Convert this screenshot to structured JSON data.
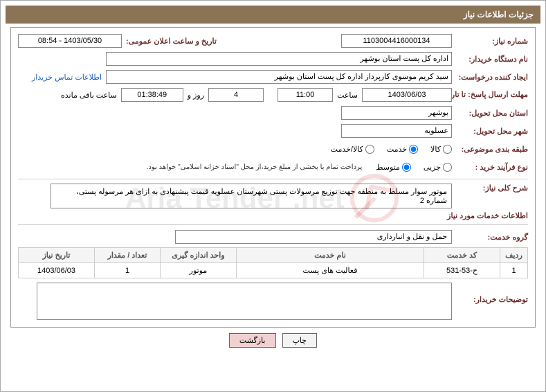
{
  "header": {
    "title": "جزئیات اطلاعات نیاز"
  },
  "labels": {
    "need_no": "شماره نیاز:",
    "announce_dt": "تاریخ و ساعت اعلان عمومی:",
    "buyer_org": "نام دستگاه خریدار:",
    "requester": "ایجاد کننده درخواست:",
    "contact_link": "اطلاعات تماس خریدار",
    "reply_deadline": "مهلت ارسال پاسخ: تا تاریخ:",
    "hour": "ساعت",
    "day_and": "روز و",
    "remaining": "ساعت باقی مانده",
    "delivery_province": "استان محل تحویل:",
    "delivery_city": "شهر محل تحویل:",
    "subject_class": "طبقه بندی موضوعی:",
    "purchase_type": "نوع فرآیند خرید :",
    "payment_note": "پرداخت تمام یا بخشی از مبلغ خرید،از محل \"اسناد خزانه اسلامی\" خواهد بود.",
    "overall_desc": "شرح کلی نیاز:",
    "service_info": "اطلاعات خدمات مورد نیاز",
    "service_group": "گروه خدمت:",
    "buyer_notes": "توضیحات خریدار:"
  },
  "values": {
    "need_no": "1103004416000134",
    "announce_dt": "1403/05/30 - 08:54",
    "buyer_org": "اداره کل پست استان بوشهر",
    "requester": "سید کریم موسوی کارپرداز اداره کل پست استان بوشهر",
    "reply_date": "1403/06/03",
    "reply_hour": "11:00",
    "days_left": "4",
    "time_left": "01:38:49",
    "delivery_province": "بوشهر",
    "delivery_city": "عسلویه",
    "overall_desc": "موتور سوار مسلط به منطقه جهت توزیع مرسولات پستی شهرستان عسلویه قیمت پیشنهادی به ازای هر مرسوله پستی، شماره 2",
    "service_group": "حمل و نقل و انبارداری"
  },
  "subject_options": {
    "goods": "کالا",
    "service": "خدمت",
    "both": "کالا/خدمت"
  },
  "purchase_options": {
    "partial": "جزیی",
    "medium": "متوسط"
  },
  "table": {
    "headers": {
      "row": "ردیف",
      "code": "کد خدمت",
      "name": "نام خدمت",
      "unit": "واحد اندازه گیری",
      "qty": "تعداد / مقدار",
      "need_date": "تاریخ نیاز"
    },
    "rows": [
      {
        "row": "1",
        "code": "ح-53-531",
        "name": "فعالیت های پست",
        "unit": "موتور",
        "qty": "1",
        "need_date": "1403/06/03"
      }
    ]
  },
  "buttons": {
    "print": "چاپ",
    "back": "بازگشت"
  },
  "watermark": "Aria Tender .net"
}
